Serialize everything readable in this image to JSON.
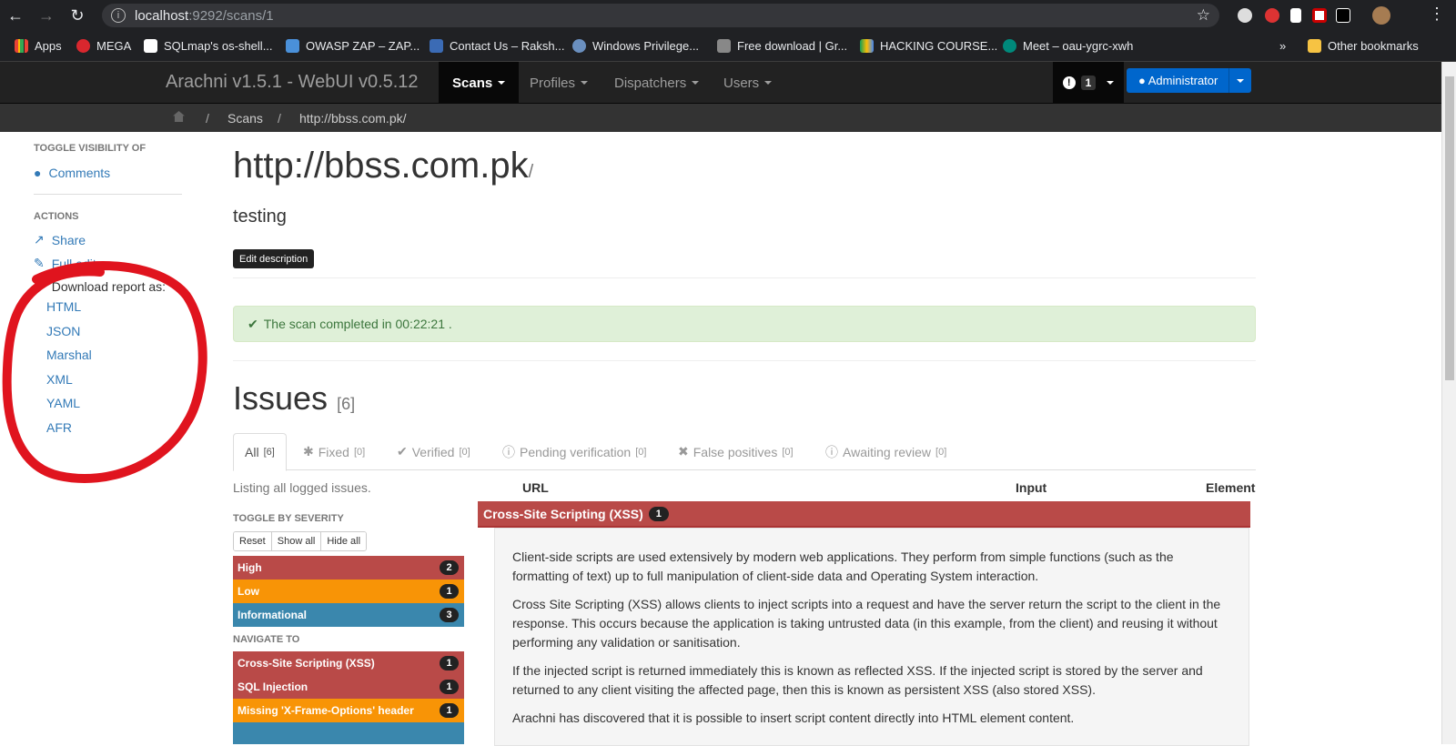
{
  "browser": {
    "url_host": "localhost",
    "url_path": ":9292/scans/1",
    "bookmarks": [
      "Apps",
      "MEGA",
      "SQLmap's os-shell...",
      "OWASP ZAP – ZAP...",
      "Contact Us – Raksh...",
      "Windows Privilege...",
      "Free download | Gr...",
      "HACKING COURSE...",
      "Meet – oau-ygrc-xwh"
    ],
    "overflow": "»",
    "other_bookmarks": "Other bookmarks"
  },
  "nav": {
    "brand": "Arachni v1.5.1 - WebUI v0.5.12",
    "items": [
      "Scans",
      "Profiles",
      "Dispatchers",
      "Users"
    ],
    "notif_count": "1",
    "admin": "Administrator"
  },
  "breadcrumb": {
    "sep": "/",
    "items": [
      "Scans",
      "http://bbss.com.pk/"
    ]
  },
  "sidebar": {
    "toggle_heading": "TOGGLE VISIBILITY OF",
    "comments": "Comments",
    "actions_heading": "ACTIONS",
    "share": "Share",
    "full_edit": "Full edit",
    "download": "Download report as:",
    "formats": [
      "HTML",
      "JSON",
      "Marshal",
      "XML",
      "YAML",
      "AFR"
    ]
  },
  "scan": {
    "title": "http://bbss.com.pk",
    "title_suffix": "/",
    "description": "testing",
    "edit_button": "Edit description",
    "status": "The scan completed in 00:22:21 ."
  },
  "issues": {
    "heading": "Issues",
    "count": "[6]",
    "tabs": [
      {
        "label": "All",
        "count": "[6]"
      },
      {
        "label": "Fixed",
        "count": "[0]"
      },
      {
        "label": "Verified",
        "count": "[0]"
      },
      {
        "label": "Pending verification",
        "count": "[0]"
      },
      {
        "label": "False positives",
        "count": "[0]"
      },
      {
        "label": "Awaiting review",
        "count": "[0]"
      }
    ],
    "listing": "Listing all logged issues.",
    "columns": {
      "url": "URL",
      "input": "Input",
      "element": "Element"
    },
    "severity_heading": "TOGGLE BY SEVERITY",
    "severity_buttons": [
      "Reset",
      "Show all",
      "Hide all"
    ],
    "severities": [
      {
        "label": "High",
        "count": "2"
      },
      {
        "label": "Low",
        "count": "1"
      },
      {
        "label": "Informational",
        "count": "3"
      }
    ],
    "navigate_heading": "NAVIGATE TO",
    "navigate": [
      {
        "label": "Cross-Site Scripting (XSS)",
        "count": "1"
      },
      {
        "label": "SQL Injection",
        "count": "1"
      },
      {
        "label": "Missing 'X-Frame-Options' header",
        "count": "1"
      }
    ],
    "xss": {
      "title": "Cross-Site Scripting (XSS)",
      "count": "1",
      "paragraphs": [
        "Client-side scripts are used extensively by modern web applications. They perform from simple functions (such as the formatting of text) up to full manipulation of client-side data and Operating System interaction.",
        "Cross Site Scripting (XSS) allows clients to inject scripts into a request and have the server return the script to the client in the response. This occurs because the application is taking untrusted data (in this example, from the client) and reusing it without performing any validation or sanitisation.",
        "If the injected script is returned immediately this is known as reflected XSS. If the injected script is stored by the server and returned to any client visiting the affected page, then this is known as persistent XSS (also stored XSS).",
        "Arachni has discovered that it is possible to insert script content directly into HTML element content."
      ]
    }
  },
  "colors": {
    "high": "#b94a48",
    "low": "#f89406",
    "info": "#3a87ad",
    "success_bg": "#dff0d8",
    "annotation": "#e0141e"
  }
}
